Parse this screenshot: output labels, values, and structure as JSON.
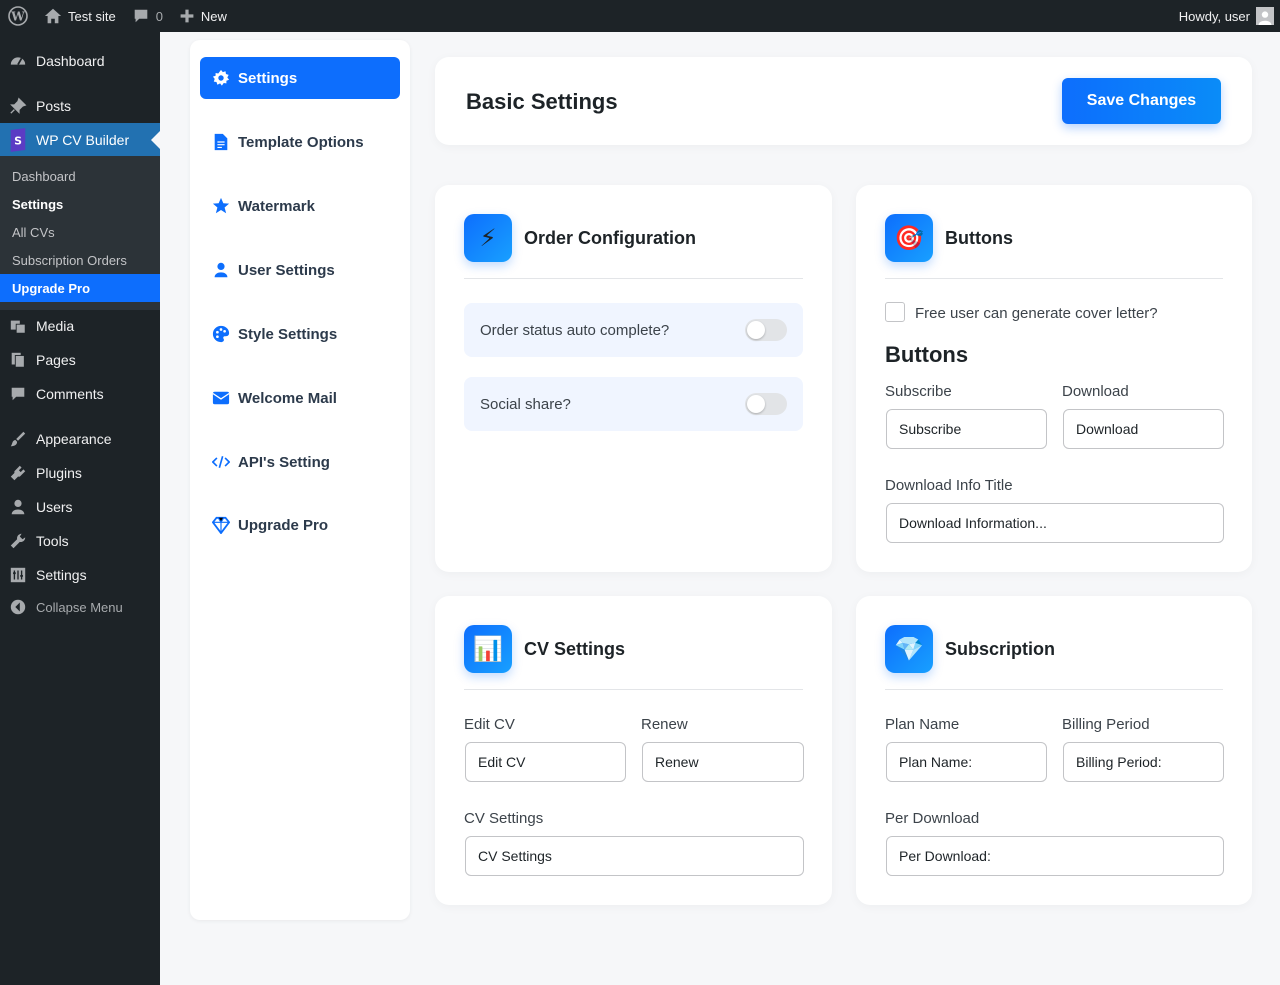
{
  "adminbar": {
    "site_name": "Test site",
    "comment_count": "0",
    "new_label": "New",
    "howdy": "Howdy, user"
  },
  "menu": {
    "dashboard": "Dashboard",
    "posts": "Posts",
    "cv_builder": "WP CV Builder",
    "submenu": [
      "Dashboard",
      "Settings",
      "All CVs",
      "Subscription Orders",
      "Upgrade Pro"
    ],
    "media": "Media",
    "pages": "Pages",
    "comments": "Comments",
    "appearance": "Appearance",
    "plugins": "Plugins",
    "users": "Users",
    "tools": "Tools",
    "settings": "Settings",
    "collapse": "Collapse Menu"
  },
  "nav": [
    "Settings",
    "Template Options",
    "Watermark",
    "User Settings",
    "Style Settings",
    "Welcome Mail",
    "API's Setting",
    "Upgrade Pro"
  ],
  "header": {
    "title": "Basic Settings",
    "save": "Save Changes"
  },
  "order": {
    "icon": "⚡",
    "title": "Order Configuration",
    "auto_complete": "Order status auto complete?",
    "social_share": "Social share?"
  },
  "buttons": {
    "icon": "🎯",
    "title": "Buttons",
    "cover_letter": "Free user can generate cover letter?",
    "heading": "Buttons",
    "subscribe_label": "Subscribe",
    "subscribe_value": "Subscribe",
    "download_label": "Download",
    "download_value": "Download",
    "info_label": "Download Info Title",
    "info_value": "Download Information..."
  },
  "cv": {
    "icon": "📊",
    "title": "CV Settings",
    "edit_label": "Edit CV",
    "edit_value": "Edit CV",
    "renew_label": "Renew",
    "renew_value": "Renew",
    "settings_label": "CV Settings",
    "settings_value": "CV Settings"
  },
  "subscription": {
    "icon": "💎",
    "title": "Subscription",
    "plan_label": "Plan Name",
    "plan_value": "Plan Name:",
    "billing_label": "Billing Period",
    "billing_value": "Billing Period:",
    "per_label": "Per Download",
    "per_value": "Per Download:"
  }
}
